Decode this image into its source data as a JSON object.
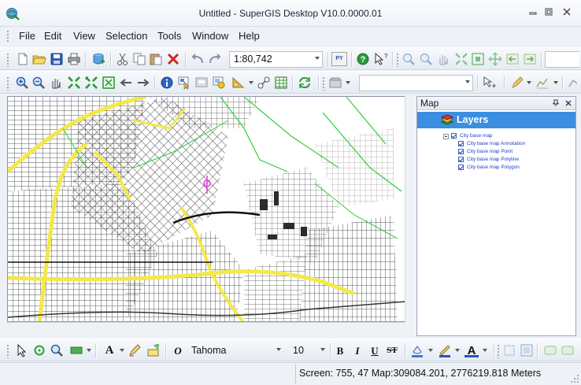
{
  "window": {
    "title": "Untitled - SuperGIS Desktop V10.0.0000.01"
  },
  "menu": [
    "File",
    "Edit",
    "View",
    "Selection",
    "Tools",
    "Window",
    "Help"
  ],
  "toolbar1": {
    "scale_value": "1:80,742",
    "python_icon_label": "PY"
  },
  "toolbar2": {
    "layer_select_value": ""
  },
  "panel": {
    "title": "Map",
    "layers_title": "Layers",
    "tree": {
      "root": "City base map",
      "children": [
        "City base map Annotation",
        "City base map Point",
        "City base map Polyline",
        "City base map Polygon"
      ]
    }
  },
  "format_toolbar": {
    "font_name": "Tahoma",
    "font_size": "10",
    "bold": "B",
    "italic": "I",
    "underline": "U",
    "strikethrough": "ST",
    "text_color_label": "A",
    "font_icon_glyph": "O"
  },
  "status": {
    "text": "Screen: 755, 47  Map:309084.201, 2776219.818 Meters"
  },
  "colors": {
    "layers_header": "#3b8ee0",
    "roads_highlight": "#f4e84a",
    "green_lines": "#2fcf3b",
    "map_lines": "#3a3a3a",
    "pin_marker": "#e33ad8"
  },
  "icons": {
    "app": "globe-app-icon",
    "toolbar1": [
      "new-file-icon",
      "open-folder-icon",
      "save-icon",
      "print-icon",
      "add-data-icon",
      "cut-icon",
      "copy-icon",
      "paste-icon",
      "delete-icon",
      "undo-icon",
      "redo-icon",
      "python-icon",
      "help-icon",
      "whats-this-icon"
    ],
    "toolbar2": [
      "zoom-in-icon",
      "zoom-out-icon",
      "pan-icon",
      "full-extent-icon",
      "zoom-fixed-icon",
      "zoom-layer-icon",
      "back-icon",
      "forward-icon",
      "identify-icon",
      "select-features-icon",
      "map-tips-icon",
      "hyperlink-icon",
      "measure-icon",
      "connect-icon",
      "table-icon",
      "refresh-icon"
    ]
  }
}
